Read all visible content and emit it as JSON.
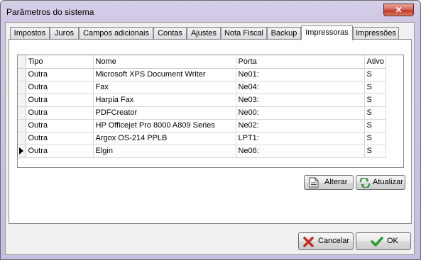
{
  "window": {
    "title": "Parâmetros do sistema",
    "close_glyph": "✕"
  },
  "tabs": [
    {
      "label": "Impostos",
      "active": false
    },
    {
      "label": "Juros",
      "active": false
    },
    {
      "label": "Campos adicionais",
      "active": false
    },
    {
      "label": "Contas",
      "active": false
    },
    {
      "label": "Ajustes",
      "active": false
    },
    {
      "label": "Nota Fiscal",
      "active": false
    },
    {
      "label": "Backup",
      "active": false
    },
    {
      "label": "Impressoras",
      "active": true
    },
    {
      "label": "Impressões",
      "active": false
    }
  ],
  "grid": {
    "columns": [
      "Tipo",
      "Nome",
      "Porta",
      "Ativo"
    ],
    "rows": [
      [
        "Outra",
        "Microsoft XPS Document Writer",
        "Ne01:",
        "S"
      ],
      [
        "Outra",
        "Fax",
        "Ne04:",
        "S"
      ],
      [
        "Outra",
        "Harpia Fax",
        "Ne03:",
        "S"
      ],
      [
        "Outra",
        "PDFCreator",
        "Ne00:",
        "S"
      ],
      [
        "Outra",
        "HP Officejet Pro 8000 A809 Series",
        "Ne02:",
        "S"
      ],
      [
        "Outra",
        "Argox OS-214 PPLB",
        "LPT1:",
        "S"
      ],
      [
        "Outra",
        "Elgin",
        "Ne06:",
        "S"
      ]
    ],
    "current_row": 6
  },
  "actions": {
    "alterar": "Alterar",
    "atualizar": "Atualizar"
  },
  "footer": {
    "cancel": "Cancelar",
    "ok": "OK"
  },
  "colors": {
    "cancel_icon": "#c0302a",
    "ok_icon": "#2e9a2e",
    "refresh_icon": "#2e8b3a"
  }
}
